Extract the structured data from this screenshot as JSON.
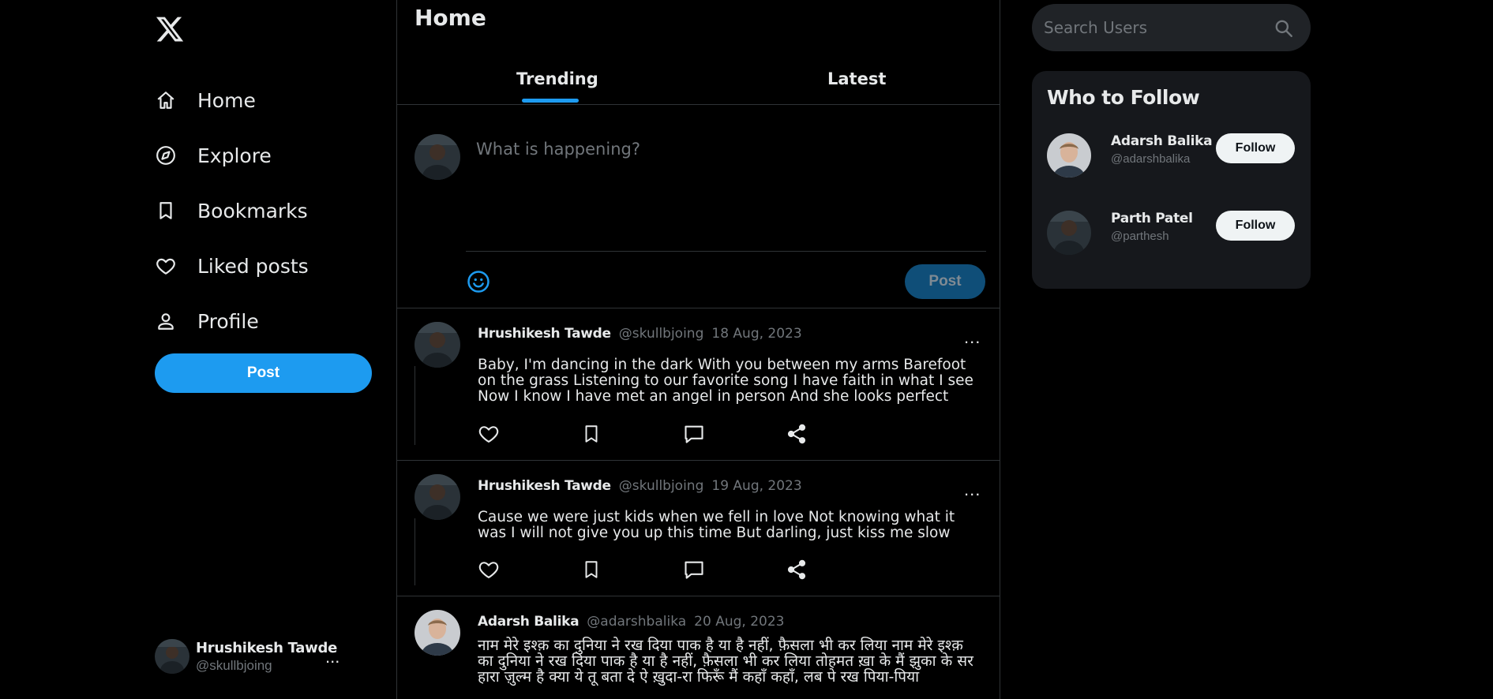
{
  "sidebar": {
    "nav": [
      {
        "label": "Home",
        "icon": "home-icon"
      },
      {
        "label": "Explore",
        "icon": "compass-icon"
      },
      {
        "label": "Bookmarks",
        "icon": "bookmark-icon"
      },
      {
        "label": "Liked posts",
        "icon": "heart-icon"
      },
      {
        "label": "Profile",
        "icon": "person-icon"
      }
    ],
    "post_label": "Post",
    "current_user": {
      "name": "Hrushikesh Tawde",
      "handle": "@skullbjoing",
      "more": "..."
    }
  },
  "main": {
    "title": "Home",
    "tabs": [
      {
        "label": "Trending"
      },
      {
        "label": "Latest"
      }
    ],
    "active_tab": "Trending",
    "composer": {
      "placeholder": "What is happening?",
      "post_label": "Post"
    },
    "tweets": [
      {
        "name": "Hrushikesh Tawde",
        "handle": "@skullbjoing",
        "date": "18 Aug, 2023",
        "more": "...",
        "text": "Baby, I'm dancing in the dark With you between my arms Barefoot on the grass Listening to our favorite song I have faith in what I see Now I know I have met an angel in person And she looks perfect"
      },
      {
        "name": "Hrushikesh Tawde",
        "handle": "@skullbjoing",
        "date": "19 Aug, 2023",
        "more": "...",
        "text": "Cause we were just kids when we fell in love Not knowing what it was I will not give you up this time But darling, just kiss me slow"
      },
      {
        "name": "Adarsh Balika",
        "handle": "@adarshbalika",
        "date": "20 Aug, 2023",
        "text": "नाम मेरे इश्क़ का दुनिया ने रख दिया पाक है या है नहीं, फ़ैसला भी कर लिया नाम मेरे इश्क़ का दुनिया ने रख दिया पाक है या है नहीं, फ़ैसला भी कर लिया तोहमत ख़ा के मैं झुका के सर हारा ज़ुल्म है क्या ये तू बता दे ऐ ख़ुदा-रा फिरूँ मैं कहाँ कहाँ, लब पे रख पिया-पिया"
      }
    ]
  },
  "right": {
    "search_placeholder": "Search Users",
    "who_to_follow": {
      "title": "Who to Follow",
      "users": [
        {
          "name": "Adarsh Balika",
          "handle": "@adarshbalika",
          "button": "Follow"
        },
        {
          "name": "Parth Patel",
          "handle": "@parthesh",
          "button": "Follow"
        }
      ]
    }
  },
  "colors": {
    "accent": "#1d9bf0",
    "background": "#000000",
    "card": "#16181c",
    "muted": "#71767b"
  }
}
